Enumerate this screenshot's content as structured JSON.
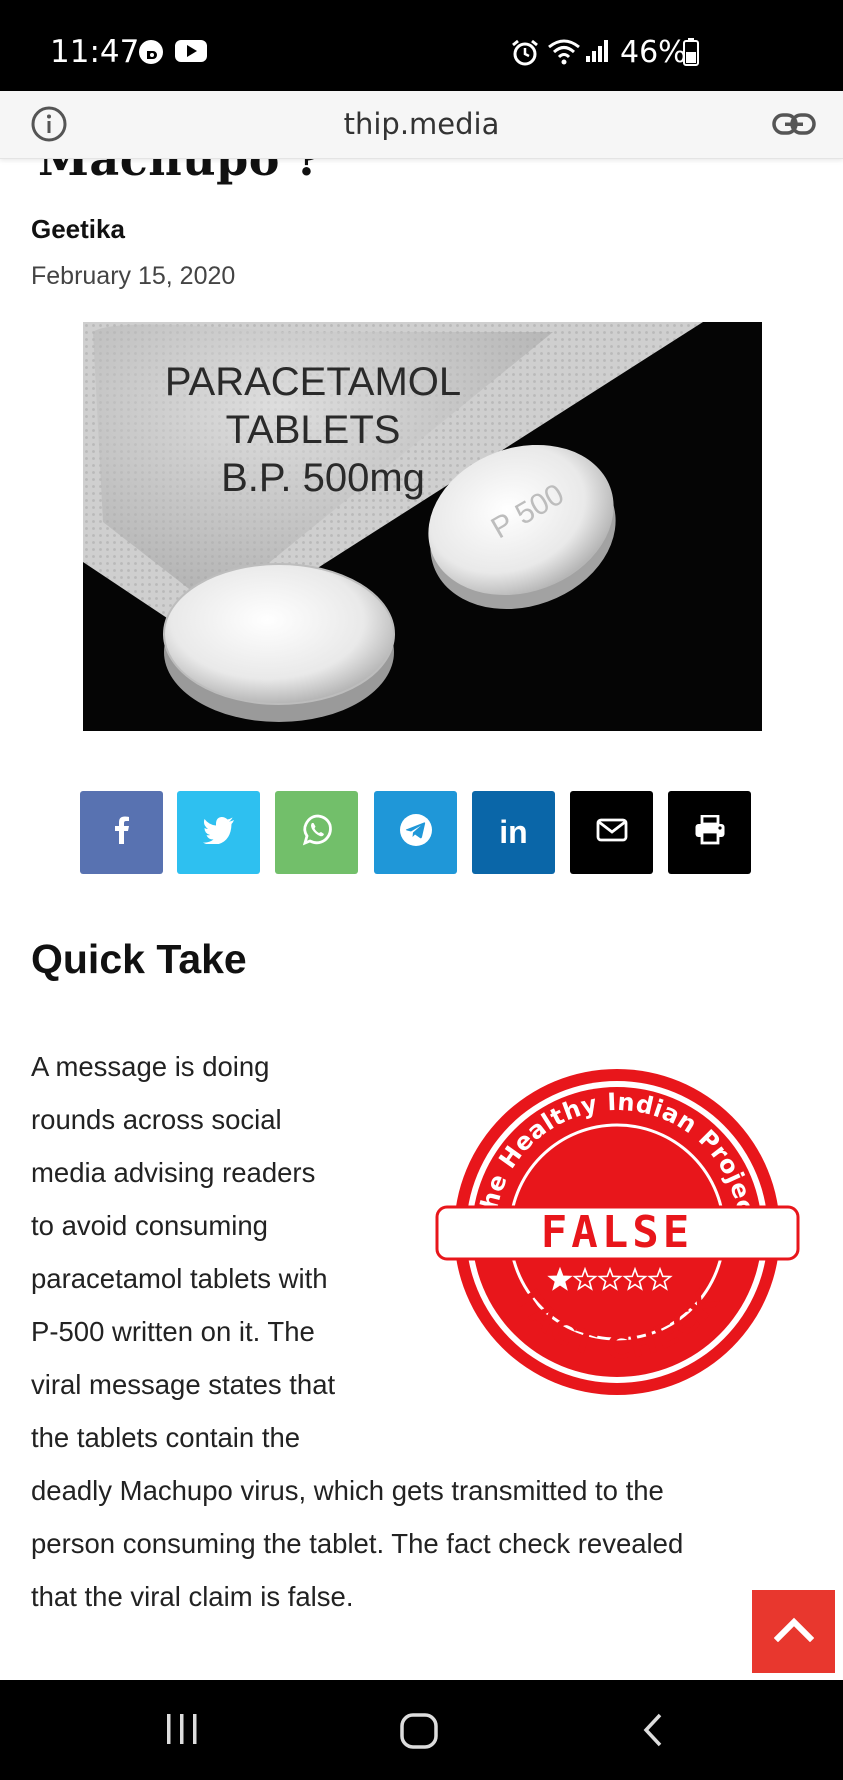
{
  "status_bar": {
    "time": "11:47",
    "battery": "46%",
    "icons": [
      "b-icon",
      "youtube-icon",
      "alarm-icon",
      "wifi-icon",
      "signal-icon",
      "battery-icon"
    ]
  },
  "browser": {
    "url": "thip.media",
    "icons": [
      "info-icon",
      "link-icon"
    ]
  },
  "article": {
    "title_fragment": "Machupo'?",
    "author": "Geetika",
    "date": "February 15, 2020",
    "image_text": [
      "PARACETAMOL",
      "TABLETS",
      "B.P. 500mg"
    ],
    "tablet_text": "P 500"
  },
  "share_buttons": [
    {
      "name": "facebook-share-button",
      "icon": "facebook-icon",
      "color": "#5872b1",
      "glyph": "f"
    },
    {
      "name": "twitter-share-button",
      "icon": "twitter-icon",
      "color": "#2ec0f0",
      "glyph": ""
    },
    {
      "name": "whatsapp-share-button",
      "icon": "whatsapp-icon",
      "color": "#72bf6a",
      "glyph": ""
    },
    {
      "name": "telegram-share-button",
      "icon": "telegram-icon",
      "color": "#1f97d8",
      "glyph": ""
    },
    {
      "name": "linkedin-share-button",
      "icon": "linkedin-icon",
      "color": "#0a66a8",
      "glyph": "in"
    },
    {
      "name": "email-share-button",
      "icon": "email-icon",
      "color": "#000000",
      "glyph": ""
    },
    {
      "name": "print-button",
      "icon": "print-icon",
      "color": "#000000",
      "glyph": ""
    }
  ],
  "quick_take": {
    "heading": "Quick Take",
    "lines": [
      "A message is doing",
      "rounds across social",
      "media advising readers",
      "to avoid consuming",
      "paracetamol tablets with",
      "P-500 written on it. The",
      "viral message states that",
      "the tablets contain the",
      "deadly Machupo virus, which gets transmitted to the",
      "person consuming the tablet. The fact check revealed",
      "that the viral claim is false."
    ]
  },
  "fact_check_badge": {
    "top_text": "The Healthy Indian Project",
    "verdict": "FALSE",
    "rating": 1,
    "rating_max": 5,
    "bottom_text": "FACT CHECK",
    "color": "#e8161b"
  },
  "scroll_top_button": {
    "icon": "chevron-up-icon",
    "color": "#e8372e"
  },
  "nav_bar": {
    "icons": [
      "recent-apps-icon",
      "home-icon",
      "back-icon"
    ]
  }
}
